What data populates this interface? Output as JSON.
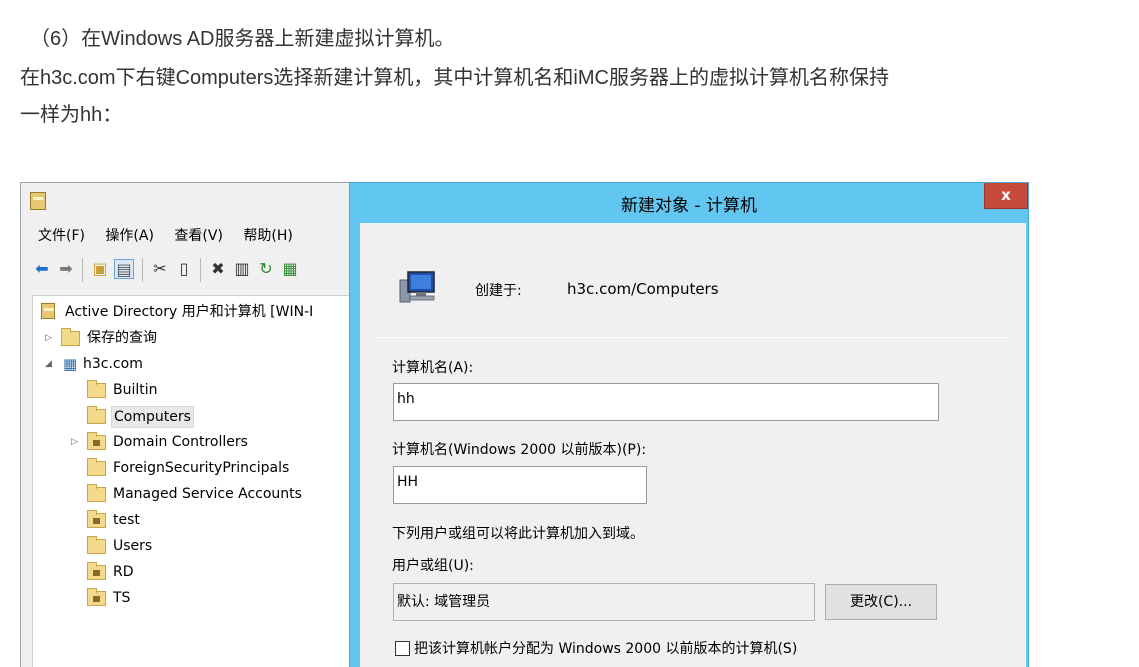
{
  "doc": {
    "line1": "（6）在Windows AD服务器上新建虚拟计算机。",
    "line2": "在h3c.com下右键Computers选择新建计算机，其中计算机名和iMC服务器上的虚拟计算机名称保持",
    "line3": "一样为hh："
  },
  "mmc": {
    "menu": [
      "文件(F)",
      "操作(A)",
      "查看(V)",
      "帮助(H)"
    ],
    "toolbar": [
      "back-icon",
      "forward-icon",
      "up-folder-icon",
      "show-hide-tree-icon",
      "cut-icon",
      "copy-icon",
      "delete-icon",
      "properties-icon",
      "refresh-icon",
      "export-icon"
    ],
    "tree": {
      "root": "Active Directory 用户和计算机 [WIN-I",
      "saved_queries": "保存的查询",
      "domain": "h3c.com",
      "children": [
        {
          "label": "Builtin",
          "kind": "folder"
        },
        {
          "label": "Computers",
          "kind": "folder",
          "selected": true
        },
        {
          "label": "Domain Controllers",
          "kind": "ou",
          "expandable": true
        },
        {
          "label": "ForeignSecurityPrincipals",
          "kind": "folder"
        },
        {
          "label": "Managed Service Accounts",
          "kind": "folder"
        },
        {
          "label": "test",
          "kind": "ou"
        },
        {
          "label": "Users",
          "kind": "folder"
        },
        {
          "label": "RD",
          "kind": "ou"
        },
        {
          "label": "TS",
          "kind": "ou"
        }
      ]
    }
  },
  "dialog": {
    "title": "新建对象 - 计算机",
    "close_label": "x",
    "created_in_label": "创建于:",
    "created_in_value": "h3c.com/Computers",
    "computer_name_label": "计算机名(A):",
    "computer_name_value": "hh",
    "pre2000_label": "计算机名(Windows 2000 以前版本)(P):",
    "pre2000_value": "HH",
    "join_text": "下列用户或组可以将此计算机加入到域。",
    "user_group_label": "用户或组(U):",
    "user_group_value": "默认: 域管理员",
    "change_button": "更改(C)...",
    "checkbox_label": "把该计算机帐户分配为 Windows 2000 以前版本的计算机(S)",
    "checkbox_checked": false
  }
}
